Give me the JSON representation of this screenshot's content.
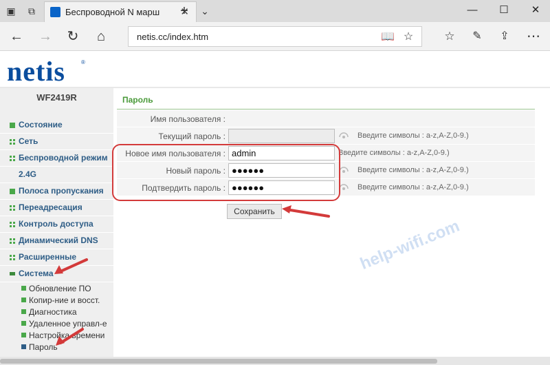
{
  "browser": {
    "tab_title": "Беспроводной N марш",
    "new_tab_icon": "+",
    "url": "netis.cc/index.htm",
    "window": {
      "minimize": "—",
      "maximize": "☐",
      "close": "✕"
    }
  },
  "brand": {
    "logo": "netis",
    "reg": "®",
    "model": "WF2419R"
  },
  "sidebar": {
    "items": [
      {
        "label": "Состояние",
        "icon": "square"
      },
      {
        "label": "Сеть",
        "icon": "grid"
      },
      {
        "label": "Беспроводной режим",
        "icon": "grid"
      },
      {
        "label": "2.4G",
        "icon": "none"
      },
      {
        "label": "Полоса пропускания",
        "icon": "square"
      },
      {
        "label": "Переадресация",
        "icon": "grid"
      },
      {
        "label": "Контроль доступа",
        "icon": "grid"
      },
      {
        "label": "Динамический DNS",
        "icon": "grid"
      },
      {
        "label": "Расширенные",
        "icon": "grid"
      },
      {
        "label": "Система",
        "icon": "open"
      }
    ],
    "sub_items": [
      {
        "label": "Обновление ПО"
      },
      {
        "label": "Копир-ние и восст."
      },
      {
        "label": "Диагностика"
      },
      {
        "label": "Удаленное управл-е"
      },
      {
        "label": "Настройка времени"
      },
      {
        "label": "Пароль"
      }
    ]
  },
  "content": {
    "title": "Пароль",
    "rows": [
      {
        "label": "Имя пользователя :",
        "value": "",
        "hint": ""
      },
      {
        "label": "Текущий пароль :",
        "value": "",
        "hint": "Введите символы : a-z,A-Z,0-9.)"
      },
      {
        "label": "Новое имя пользователя :",
        "value": "admin",
        "hint": "Введите символы : a-z,A-Z,0-9.)"
      },
      {
        "label": "Новый пароль :",
        "value": "●●●●●●",
        "hint": "Введите символы : a-z,A-Z,0-9.)"
      },
      {
        "label": "Подтвердить пароль :",
        "value": "●●●●●●",
        "hint": "Введите символы : a-z,A-Z,0-9.)"
      }
    ],
    "save_label": "Сохранить"
  },
  "watermark": "help-wifi.com",
  "colors": {
    "accent": "#0a4d9e",
    "menu_text": "#2e5d86",
    "green": "#4aa84a",
    "annotation": "#d33a3a"
  }
}
